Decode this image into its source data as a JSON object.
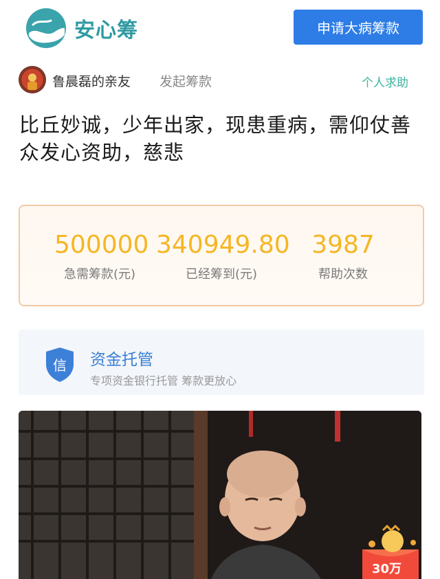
{
  "header": {
    "logo_text": "安心筹",
    "apply_button": "申请大病筹款",
    "brand_color": "#2f9aa2",
    "button_color": "#2e7de6"
  },
  "organizer": {
    "name": "鲁晨磊的亲友",
    "action": "发起筹款",
    "help_type": "个人求助"
  },
  "campaign": {
    "title": "比丘妙诚，少年出家，现患重病，需仰仗善众发心资助，慈悲"
  },
  "stats": [
    {
      "value": "500000",
      "label": "急需筹款(元)"
    },
    {
      "value": "340949.80",
      "label": "已经筹到(元)"
    },
    {
      "value": "3987",
      "label": "帮助次数"
    }
  ],
  "custody": {
    "icon_char": "信",
    "title": "资金托管",
    "subtitle": "专项资金银行托管 筹款更放心"
  },
  "badge": {
    "text": "30万"
  }
}
